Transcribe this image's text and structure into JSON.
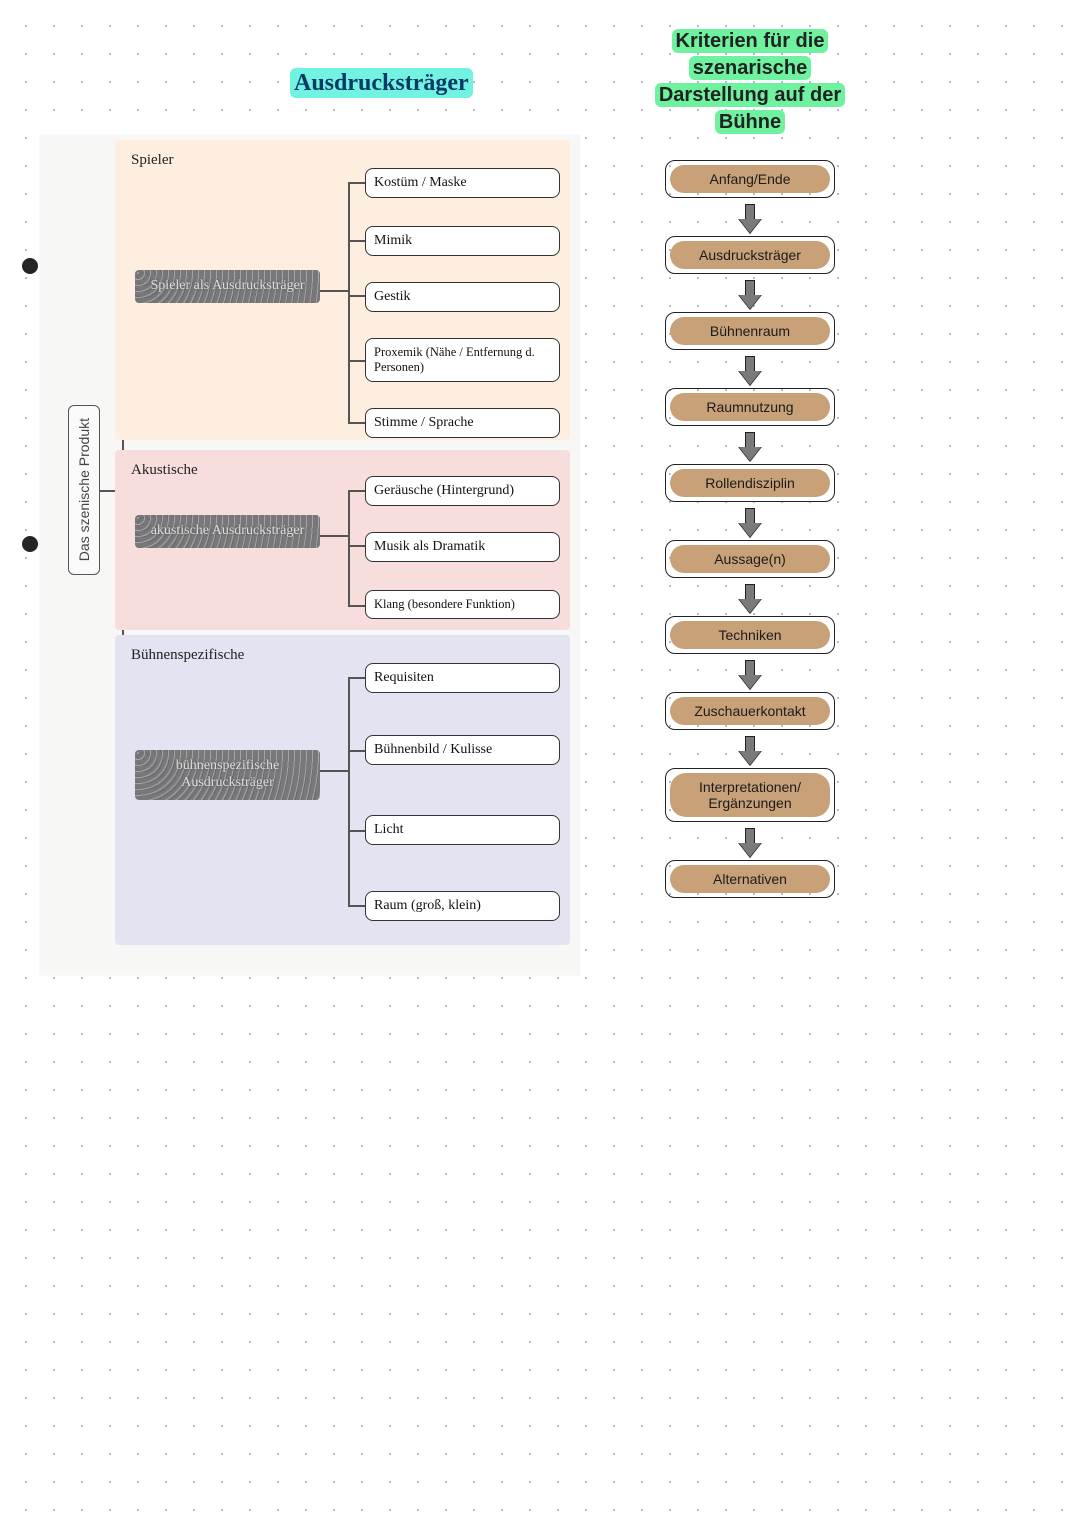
{
  "headings": {
    "left": "Ausdrucksträger",
    "right": "Kriterien für die szenarische Darstellung auf der Bühne"
  },
  "root": "Das szenische Produkt",
  "categories": [
    {
      "label": "Spieler",
      "hub": "Spieler als Ausdrucksträger",
      "leaves": [
        "Kostüm / Maske",
        "Mimik",
        "Gestik",
        "Proxemik (Nähe / Entfernung d. Personen)",
        "Stimme / Sprache"
      ]
    },
    {
      "label": "Akustische",
      "hub": "akustische Ausdrucksträger",
      "leaves": [
        "Geräusche (Hintergrund)",
        "Musik als Dramatik",
        "Klang (besondere Funktion)"
      ]
    },
    {
      "label": "Bühnenspezifische",
      "hub": "bühnenspezifische Ausdrucksträger",
      "leaves": [
        "Requisiten",
        "Bühnenbild / Kulisse",
        "Licht",
        "Raum (groß, klein)"
      ]
    }
  ],
  "flow": [
    "Anfang/Ende",
    "Ausdrucksträger",
    "Bühnenraum",
    "Raumnutzung",
    "Rollendisziplin",
    "Aussage(n)",
    "Techniken",
    "Zuschauerkontakt",
    "Interpretationen/ Ergänzungen",
    "Alternativen"
  ],
  "colors": {
    "cat1": "#fdeee0",
    "cat2": "#f7dedd",
    "cat3": "#e3e3f2",
    "hub": "#78787a",
    "pill": "#c9a179",
    "hl_left": "#72f2e0",
    "hl_right": "#6ef29f"
  }
}
